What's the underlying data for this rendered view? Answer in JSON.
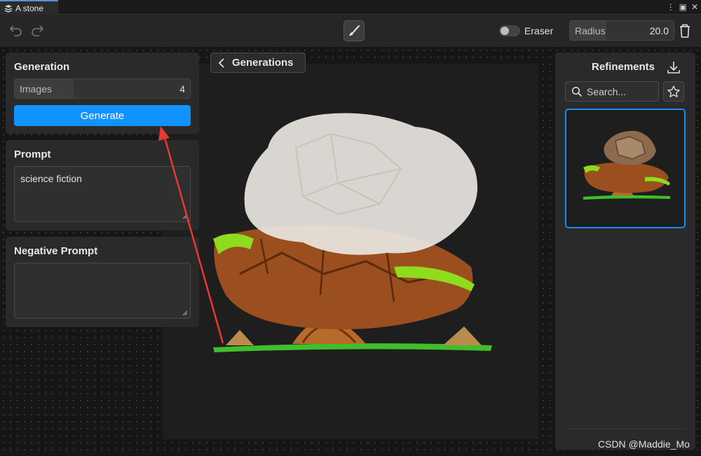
{
  "tab": {
    "title": "A stone"
  },
  "toolbar": {
    "eraser_label": "Eraser",
    "radius_label": "Radius",
    "radius_value": "20.0"
  },
  "generation": {
    "title": "Generation",
    "images_label": "Images",
    "images_value": "4",
    "generate_label": "Generate"
  },
  "prompt": {
    "title": "Prompt",
    "value": "science fiction"
  },
  "negative_prompt": {
    "title": "Negative Prompt",
    "value": ""
  },
  "canvas": {
    "back_label": "Generations"
  },
  "refinements": {
    "title": "Refinements",
    "search_placeholder": "Search..."
  },
  "watermark": "CSDN @Maddie_Mo",
  "colors": {
    "accent": "#1092ff",
    "selection": "#1b8cf2",
    "annotation": "#e53935"
  }
}
